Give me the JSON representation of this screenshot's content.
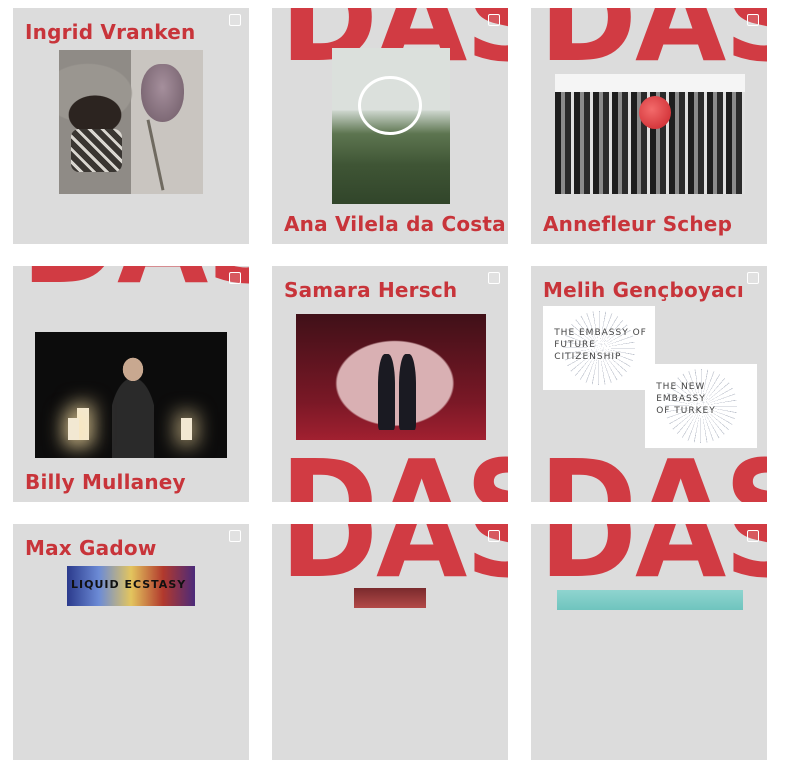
{
  "logo_text": "DAS",
  "colors": {
    "accent": "#c8343a",
    "card_bg": "#dcdcdc",
    "page_bg": "#ffffff"
  },
  "cards": [
    {
      "artist": "Ingrid Vranken"
    },
    {
      "artist": "Ana Vilela da Costa"
    },
    {
      "artist": "Annefleur Schep"
    },
    {
      "artist": "Billy Mullaney"
    },
    {
      "artist": "Samara Hersch"
    },
    {
      "artist": "Melih Gençboyacı"
    },
    {
      "artist": "Max Gadow"
    },
    {
      "artist": ""
    },
    {
      "artist": ""
    }
  ],
  "embassy": {
    "poster1": [
      "THE EMBASSY OF",
      "FUTURE",
      "CITIZENSHIP"
    ],
    "poster2": [
      "THE NEW",
      "EMBASSY",
      "OF TURKEY"
    ]
  },
  "liquid_text": "LIQUID ECSTASY"
}
